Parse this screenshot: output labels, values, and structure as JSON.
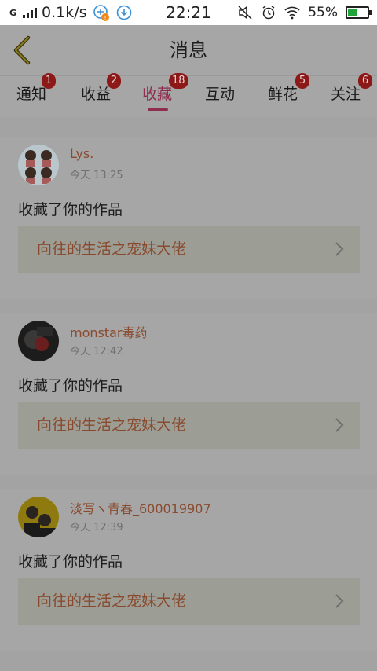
{
  "status_bar": {
    "network_type": "G",
    "speed": "0.1k/s",
    "time": "22:21",
    "battery_percent": "55%",
    "battery_level": 0.55
  },
  "header": {
    "title": "消息"
  },
  "tabs": [
    {
      "label": "通知",
      "badge": "1",
      "active": false
    },
    {
      "label": "收益",
      "badge": "2",
      "active": false
    },
    {
      "label": "收藏",
      "badge": "18",
      "active": true
    },
    {
      "label": "互动",
      "badge": "",
      "active": false
    },
    {
      "label": "鲜花",
      "badge": "5",
      "active": false
    },
    {
      "label": "关注",
      "badge": "6",
      "active": false
    }
  ],
  "feed": [
    {
      "user": "Lys.",
      "time": "今天 13:25",
      "action": "收藏了你的作品",
      "work_title": "向往的生活之宠妹大佬"
    },
    {
      "user": "monstar毒药",
      "time": "今天 12:42",
      "action": "收藏了你的作品",
      "work_title": "向往的生活之宠妹大佬"
    },
    {
      "user": "淡写ヽ青春_600019907",
      "time": "今天 12:39",
      "action": "收藏了你的作品",
      "work_title": "向往的生活之宠妹大佬"
    }
  ],
  "colors": {
    "accent": "#8e2d4f",
    "badge": "#8c1818",
    "username": "#8a4a2e",
    "battery": "#1fa43a"
  }
}
